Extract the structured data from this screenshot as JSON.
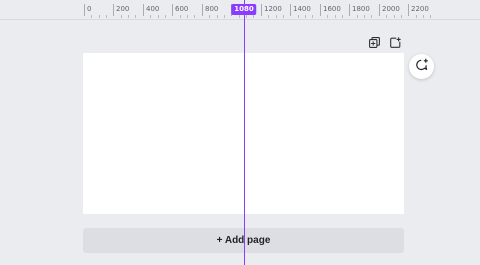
{
  "ruler": {
    "labels": [
      "0",
      "200",
      "400",
      "600",
      "800",
      "10",
      "1200",
      "1400",
      "1600",
      "1800",
      "2000",
      "2200"
    ],
    "cursor_value": "1080"
  },
  "page_toolbar": {
    "duplicate_icon": "duplicate-page-icon",
    "add_icon": "add-page-icon"
  },
  "comment": {
    "icon": "comment-add-icon"
  },
  "add_page": {
    "label": "+ Add page"
  },
  "colors": {
    "accent": "#8b3dff",
    "background": "#ebecf0",
    "page": "#ffffff"
  }
}
